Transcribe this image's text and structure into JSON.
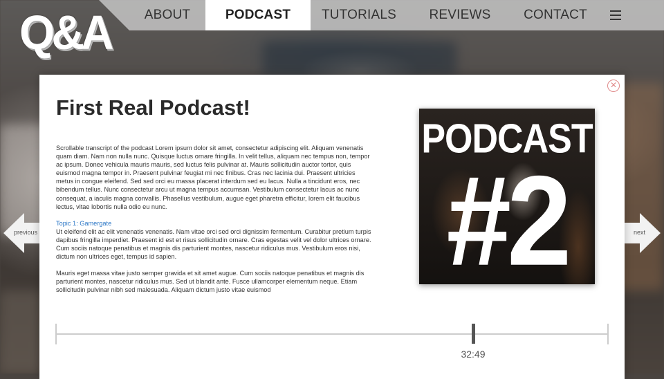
{
  "logo": {
    "text": "Q&A"
  },
  "nav": {
    "items": [
      {
        "label": "ABOUT",
        "active": false
      },
      {
        "label": "PODCAST",
        "active": true
      },
      {
        "label": "TUTORIALS",
        "active": false
      },
      {
        "label": "REVIEWS",
        "active": false
      },
      {
        "label": "CONTACT",
        "active": false
      }
    ],
    "menu_icon": "hamburger-menu-icon"
  },
  "arrows": {
    "previous": "previous",
    "next": "next"
  },
  "modal": {
    "close_icon": "close-circle-icon",
    "title": "First Real Podcast!",
    "transcript": [
      "Scrollable transcript of the podcast Lorem ipsum dolor sit amet, consectetur adipiscing elit. Aliquam venenatis quam diam. Nam non nulla nunc. Quisque luctus ornare fringilla. In velit tellus, aliquam nec tempus non, tempor ac ipsum. Donec vehicula mauris mauris, sed luctus felis pulvinar at. Mauris sollicitudin auctor tortor, quis euismod magna tempor in. Praesent pulvinar feugiat mi nec finibus. Cras nec lacinia dui. Praesent ultricies metus in congue eleifend. Sed sed orci eu massa placerat interdum sed eu lacus. Nulla a tincidunt eros, nec bibendum tellus. Nunc consectetur arcu ut magna tempus accumsan. Vestibulum consectetur lacus ac nunc consequat, a iaculis magna convallis. Phasellus vestibulum, augue eget pharetra efficitur, lorem elit faucibus lectus, vitae lobortis nulla odio eu nunc.",
      "Ut eleifend elit ac elit venenatis venenatis. Nam vitae orci sed orci dignissim fermentum. Curabitur pretium turpis dapibus fringilla imperdiet. Praesent id est et risus sollicitudin ornare. Cras egestas velit vel dolor ultrices ornare. Cum sociis natoque penatibus et magnis dis parturient montes, nascetur ridiculus mus. Vestibulum eros nisi, dictum non ultrices eget, tempus id sapien.",
      "Mauris eget massa vitae justo semper gravida et sit amet augue. Cum sociis natoque penatibus et magnis dis parturient montes, nascetur ridiculus mus. Sed ut blandit ante. Fusce ullamcorper elementum neque. Etiam sollicitudin pulvinar nibh sed malesuada. Aliquam dictum justo vitae euismod"
    ],
    "topic_label": "Topic 1: Gamergate",
    "cover": {
      "word": "PODCAST",
      "number": "#2"
    },
    "player": {
      "current_time": "32:49",
      "progress": 0.755
    }
  },
  "colors": {
    "topic_link": "#2a76c6",
    "close": "#e08a8a",
    "active_nav_bg": "#ffffff"
  }
}
